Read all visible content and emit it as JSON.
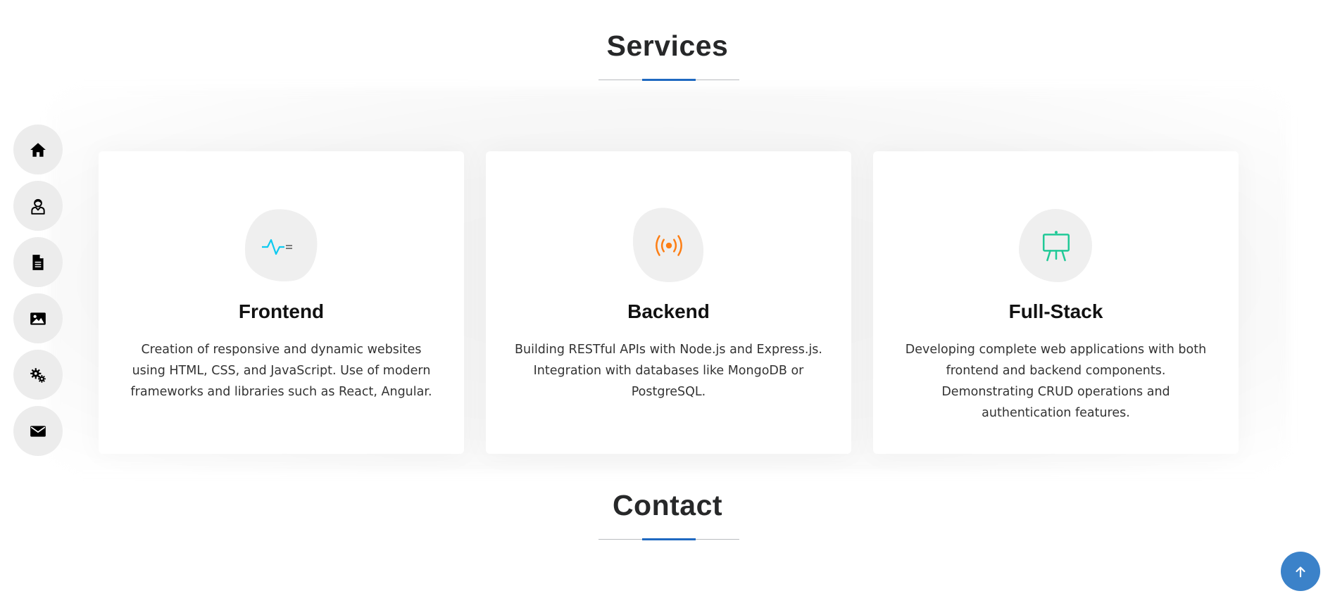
{
  "sidenav": {
    "items": [
      {
        "name": "home",
        "icon": "home-icon"
      },
      {
        "name": "about",
        "icon": "user-icon"
      },
      {
        "name": "resume",
        "icon": "document-icon"
      },
      {
        "name": "portfolio",
        "icon": "image-icon"
      },
      {
        "name": "services",
        "icon": "gears-icon"
      },
      {
        "name": "contact",
        "icon": "envelope-icon"
      }
    ]
  },
  "services": {
    "title": "Services",
    "cards": [
      {
        "title": "Frontend",
        "icon": "activity-icon",
        "icon_color": "#0dcaf0",
        "description": "Creation of responsive and dynamic websites using HTML, CSS, and JavaScript. Use of modern frameworks and libraries such as React, Angular."
      },
      {
        "title": "Backend",
        "icon": "broadcast-icon",
        "icon_color": "#fd7e14",
        "description": "Building RESTful APIs with Node.js and Express.js. Integration with databases like MongoDB or PostgreSQL."
      },
      {
        "title": "Full-Stack",
        "icon": "easel-icon",
        "icon_color": "#20c997",
        "description": "Developing complete web applications with both frontend and backend components. Demonstrating CRUD operations and authentication features."
      }
    ]
  },
  "contact": {
    "title": "Contact"
  },
  "colors": {
    "accent": "#1f69c1",
    "back_top": "#3b82c9"
  }
}
